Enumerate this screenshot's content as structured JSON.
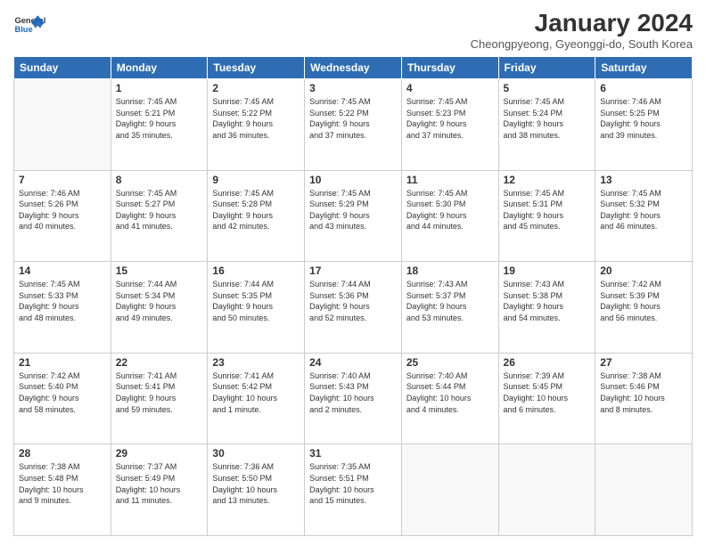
{
  "header": {
    "logo_line1": "General",
    "logo_line2": "Blue",
    "title": "January 2024",
    "location": "Cheongpyeong, Gyeonggi-do, South Korea"
  },
  "weekdays": [
    "Sunday",
    "Monday",
    "Tuesday",
    "Wednesday",
    "Thursday",
    "Friday",
    "Saturday"
  ],
  "weeks": [
    [
      {
        "day": "",
        "info": ""
      },
      {
        "day": "1",
        "info": "Sunrise: 7:45 AM\nSunset: 5:21 PM\nDaylight: 9 hours\nand 35 minutes."
      },
      {
        "day": "2",
        "info": "Sunrise: 7:45 AM\nSunset: 5:22 PM\nDaylight: 9 hours\nand 36 minutes."
      },
      {
        "day": "3",
        "info": "Sunrise: 7:45 AM\nSunset: 5:22 PM\nDaylight: 9 hours\nand 37 minutes."
      },
      {
        "day": "4",
        "info": "Sunrise: 7:45 AM\nSunset: 5:23 PM\nDaylight: 9 hours\nand 37 minutes."
      },
      {
        "day": "5",
        "info": "Sunrise: 7:45 AM\nSunset: 5:24 PM\nDaylight: 9 hours\nand 38 minutes."
      },
      {
        "day": "6",
        "info": "Sunrise: 7:46 AM\nSunset: 5:25 PM\nDaylight: 9 hours\nand 39 minutes."
      }
    ],
    [
      {
        "day": "7",
        "info": "Sunrise: 7:46 AM\nSunset: 5:26 PM\nDaylight: 9 hours\nand 40 minutes."
      },
      {
        "day": "8",
        "info": "Sunrise: 7:45 AM\nSunset: 5:27 PM\nDaylight: 9 hours\nand 41 minutes."
      },
      {
        "day": "9",
        "info": "Sunrise: 7:45 AM\nSunset: 5:28 PM\nDaylight: 9 hours\nand 42 minutes."
      },
      {
        "day": "10",
        "info": "Sunrise: 7:45 AM\nSunset: 5:29 PM\nDaylight: 9 hours\nand 43 minutes."
      },
      {
        "day": "11",
        "info": "Sunrise: 7:45 AM\nSunset: 5:30 PM\nDaylight: 9 hours\nand 44 minutes."
      },
      {
        "day": "12",
        "info": "Sunrise: 7:45 AM\nSunset: 5:31 PM\nDaylight: 9 hours\nand 45 minutes."
      },
      {
        "day": "13",
        "info": "Sunrise: 7:45 AM\nSunset: 5:32 PM\nDaylight: 9 hours\nand 46 minutes."
      }
    ],
    [
      {
        "day": "14",
        "info": "Sunrise: 7:45 AM\nSunset: 5:33 PM\nDaylight: 9 hours\nand 48 minutes."
      },
      {
        "day": "15",
        "info": "Sunrise: 7:44 AM\nSunset: 5:34 PM\nDaylight: 9 hours\nand 49 minutes."
      },
      {
        "day": "16",
        "info": "Sunrise: 7:44 AM\nSunset: 5:35 PM\nDaylight: 9 hours\nand 50 minutes."
      },
      {
        "day": "17",
        "info": "Sunrise: 7:44 AM\nSunset: 5:36 PM\nDaylight: 9 hours\nand 52 minutes."
      },
      {
        "day": "18",
        "info": "Sunrise: 7:43 AM\nSunset: 5:37 PM\nDaylight: 9 hours\nand 53 minutes."
      },
      {
        "day": "19",
        "info": "Sunrise: 7:43 AM\nSunset: 5:38 PM\nDaylight: 9 hours\nand 54 minutes."
      },
      {
        "day": "20",
        "info": "Sunrise: 7:42 AM\nSunset: 5:39 PM\nDaylight: 9 hours\nand 56 minutes."
      }
    ],
    [
      {
        "day": "21",
        "info": "Sunrise: 7:42 AM\nSunset: 5:40 PM\nDaylight: 9 hours\nand 58 minutes."
      },
      {
        "day": "22",
        "info": "Sunrise: 7:41 AM\nSunset: 5:41 PM\nDaylight: 9 hours\nand 59 minutes."
      },
      {
        "day": "23",
        "info": "Sunrise: 7:41 AM\nSunset: 5:42 PM\nDaylight: 10 hours\nand 1 minute."
      },
      {
        "day": "24",
        "info": "Sunrise: 7:40 AM\nSunset: 5:43 PM\nDaylight: 10 hours\nand 2 minutes."
      },
      {
        "day": "25",
        "info": "Sunrise: 7:40 AM\nSunset: 5:44 PM\nDaylight: 10 hours\nand 4 minutes."
      },
      {
        "day": "26",
        "info": "Sunrise: 7:39 AM\nSunset: 5:45 PM\nDaylight: 10 hours\nand 6 minutes."
      },
      {
        "day": "27",
        "info": "Sunrise: 7:38 AM\nSunset: 5:46 PM\nDaylight: 10 hours\nand 8 minutes."
      }
    ],
    [
      {
        "day": "28",
        "info": "Sunrise: 7:38 AM\nSunset: 5:48 PM\nDaylight: 10 hours\nand 9 minutes."
      },
      {
        "day": "29",
        "info": "Sunrise: 7:37 AM\nSunset: 5:49 PM\nDaylight: 10 hours\nand 11 minutes."
      },
      {
        "day": "30",
        "info": "Sunrise: 7:36 AM\nSunset: 5:50 PM\nDaylight: 10 hours\nand 13 minutes."
      },
      {
        "day": "31",
        "info": "Sunrise: 7:35 AM\nSunset: 5:51 PM\nDaylight: 10 hours\nand 15 minutes."
      },
      {
        "day": "",
        "info": ""
      },
      {
        "day": "",
        "info": ""
      },
      {
        "day": "",
        "info": ""
      }
    ]
  ]
}
